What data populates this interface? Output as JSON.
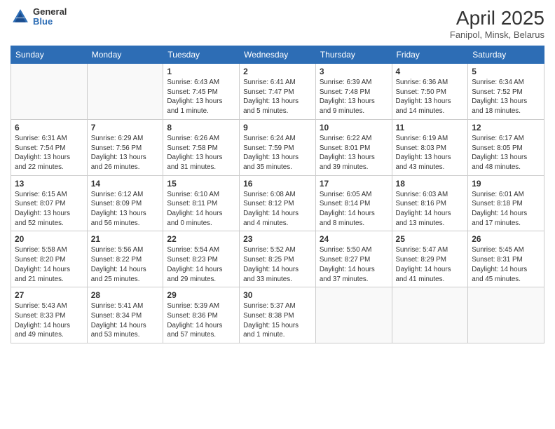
{
  "header": {
    "logo_general": "General",
    "logo_blue": "Blue",
    "main_title": "April 2025",
    "subtitle": "Fanipol, Minsk, Belarus"
  },
  "weekdays": [
    "Sunday",
    "Monday",
    "Tuesday",
    "Wednesday",
    "Thursday",
    "Friday",
    "Saturday"
  ],
  "weeks": [
    [
      {
        "date": "",
        "info": ""
      },
      {
        "date": "",
        "info": ""
      },
      {
        "date": "1",
        "info": "Sunrise: 6:43 AM\nSunset: 7:45 PM\nDaylight: 13 hours and 1 minute."
      },
      {
        "date": "2",
        "info": "Sunrise: 6:41 AM\nSunset: 7:47 PM\nDaylight: 13 hours and 5 minutes."
      },
      {
        "date": "3",
        "info": "Sunrise: 6:39 AM\nSunset: 7:48 PM\nDaylight: 13 hours and 9 minutes."
      },
      {
        "date": "4",
        "info": "Sunrise: 6:36 AM\nSunset: 7:50 PM\nDaylight: 13 hours and 14 minutes."
      },
      {
        "date": "5",
        "info": "Sunrise: 6:34 AM\nSunset: 7:52 PM\nDaylight: 13 hours and 18 minutes."
      }
    ],
    [
      {
        "date": "6",
        "info": "Sunrise: 6:31 AM\nSunset: 7:54 PM\nDaylight: 13 hours and 22 minutes."
      },
      {
        "date": "7",
        "info": "Sunrise: 6:29 AM\nSunset: 7:56 PM\nDaylight: 13 hours and 26 minutes."
      },
      {
        "date": "8",
        "info": "Sunrise: 6:26 AM\nSunset: 7:58 PM\nDaylight: 13 hours and 31 minutes."
      },
      {
        "date": "9",
        "info": "Sunrise: 6:24 AM\nSunset: 7:59 PM\nDaylight: 13 hours and 35 minutes."
      },
      {
        "date": "10",
        "info": "Sunrise: 6:22 AM\nSunset: 8:01 PM\nDaylight: 13 hours and 39 minutes."
      },
      {
        "date": "11",
        "info": "Sunrise: 6:19 AM\nSunset: 8:03 PM\nDaylight: 13 hours and 43 minutes."
      },
      {
        "date": "12",
        "info": "Sunrise: 6:17 AM\nSunset: 8:05 PM\nDaylight: 13 hours and 48 minutes."
      }
    ],
    [
      {
        "date": "13",
        "info": "Sunrise: 6:15 AM\nSunset: 8:07 PM\nDaylight: 13 hours and 52 minutes."
      },
      {
        "date": "14",
        "info": "Sunrise: 6:12 AM\nSunset: 8:09 PM\nDaylight: 13 hours and 56 minutes."
      },
      {
        "date": "15",
        "info": "Sunrise: 6:10 AM\nSunset: 8:11 PM\nDaylight: 14 hours and 0 minutes."
      },
      {
        "date": "16",
        "info": "Sunrise: 6:08 AM\nSunset: 8:12 PM\nDaylight: 14 hours and 4 minutes."
      },
      {
        "date": "17",
        "info": "Sunrise: 6:05 AM\nSunset: 8:14 PM\nDaylight: 14 hours and 8 minutes."
      },
      {
        "date": "18",
        "info": "Sunrise: 6:03 AM\nSunset: 8:16 PM\nDaylight: 14 hours and 13 minutes."
      },
      {
        "date": "19",
        "info": "Sunrise: 6:01 AM\nSunset: 8:18 PM\nDaylight: 14 hours and 17 minutes."
      }
    ],
    [
      {
        "date": "20",
        "info": "Sunrise: 5:58 AM\nSunset: 8:20 PM\nDaylight: 14 hours and 21 minutes."
      },
      {
        "date": "21",
        "info": "Sunrise: 5:56 AM\nSunset: 8:22 PM\nDaylight: 14 hours and 25 minutes."
      },
      {
        "date": "22",
        "info": "Sunrise: 5:54 AM\nSunset: 8:23 PM\nDaylight: 14 hours and 29 minutes."
      },
      {
        "date": "23",
        "info": "Sunrise: 5:52 AM\nSunset: 8:25 PM\nDaylight: 14 hours and 33 minutes."
      },
      {
        "date": "24",
        "info": "Sunrise: 5:50 AM\nSunset: 8:27 PM\nDaylight: 14 hours and 37 minutes."
      },
      {
        "date": "25",
        "info": "Sunrise: 5:47 AM\nSunset: 8:29 PM\nDaylight: 14 hours and 41 minutes."
      },
      {
        "date": "26",
        "info": "Sunrise: 5:45 AM\nSunset: 8:31 PM\nDaylight: 14 hours and 45 minutes."
      }
    ],
    [
      {
        "date": "27",
        "info": "Sunrise: 5:43 AM\nSunset: 8:33 PM\nDaylight: 14 hours and 49 minutes."
      },
      {
        "date": "28",
        "info": "Sunrise: 5:41 AM\nSunset: 8:34 PM\nDaylight: 14 hours and 53 minutes."
      },
      {
        "date": "29",
        "info": "Sunrise: 5:39 AM\nSunset: 8:36 PM\nDaylight: 14 hours and 57 minutes."
      },
      {
        "date": "30",
        "info": "Sunrise: 5:37 AM\nSunset: 8:38 PM\nDaylight: 15 hours and 1 minute."
      },
      {
        "date": "",
        "info": ""
      },
      {
        "date": "",
        "info": ""
      },
      {
        "date": "",
        "info": ""
      }
    ]
  ]
}
